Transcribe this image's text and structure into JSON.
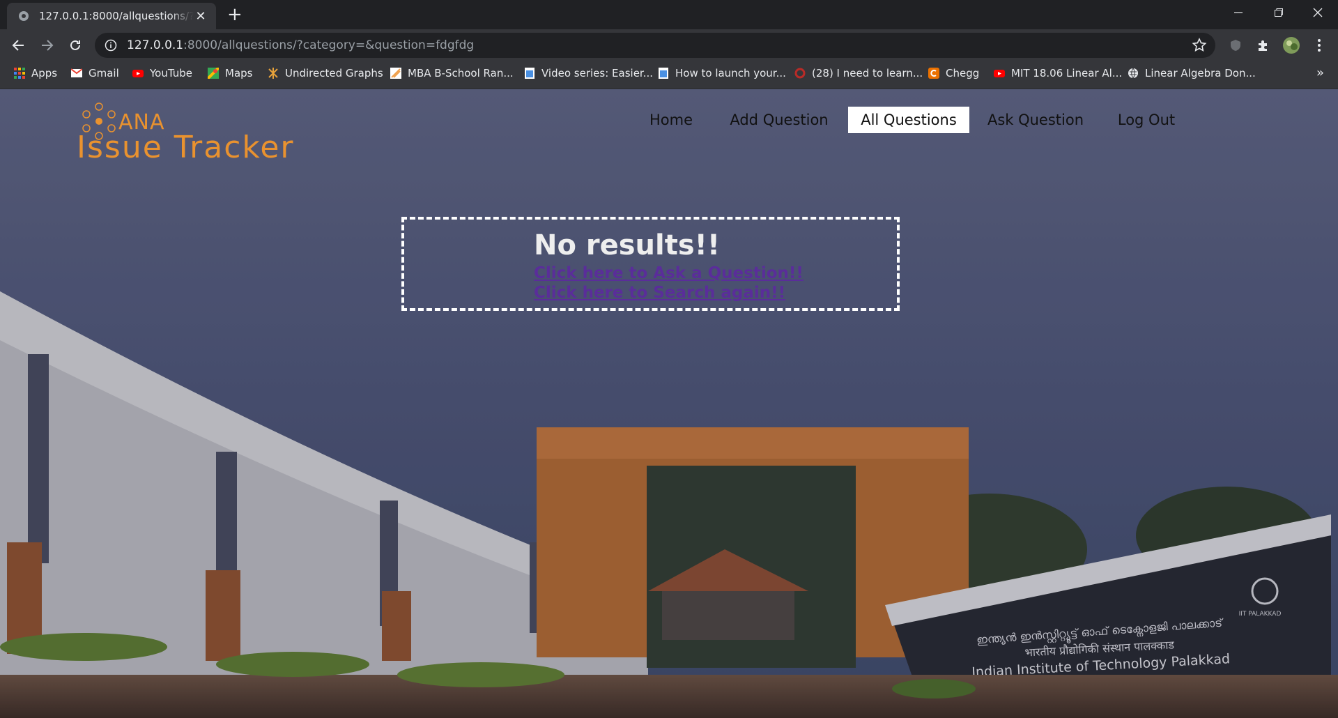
{
  "browser": {
    "tab_title": "127.0.0.1:8000/allquestions/?category=&question=fdgfdg",
    "url_host": "127.0.0.1",
    "url_rest": ":8000/allquestions/?category=&question=fdgfdg",
    "bookmarks": [
      {
        "label": "Apps",
        "icon": "apps-grid-icon",
        "color": "#4285f4"
      },
      {
        "label": "Gmail",
        "icon": "gmail-icon",
        "color": "#ea4335"
      },
      {
        "label": "YouTube",
        "icon": "youtube-icon",
        "color": "#ff0000"
      },
      {
        "label": "Maps",
        "icon": "maps-icon",
        "color": "#34a853"
      },
      {
        "label": "Undirected Graphs",
        "icon": "graph-icon",
        "color": "#e8a33a"
      },
      {
        "label": "MBA B-School Ran...",
        "icon": "ranking-icon",
        "color": "#f0a04b"
      },
      {
        "label": "Video series: Easier...",
        "icon": "docs-icon",
        "color": "#4a90e2"
      },
      {
        "label": "How to launch your...",
        "icon": "docs-icon",
        "color": "#4a90e2"
      },
      {
        "label": "(28) I need to learn...",
        "icon": "quora-icon",
        "color": "#b92b27"
      },
      {
        "label": "Chegg",
        "icon": "chegg-icon",
        "color": "#eb7100"
      },
      {
        "label": "MIT 18.06 Linear Al...",
        "icon": "youtube-icon",
        "color": "#ff0000"
      },
      {
        "label": "Linear Algebra Don...",
        "icon": "globe-icon",
        "color": "#e8eaed"
      }
    ],
    "more": "»"
  },
  "site": {
    "logo_top": "ANA",
    "logo_bottom": "Issue Tracker",
    "accent": "#e9922f",
    "nav": [
      {
        "label": "Home",
        "active": false
      },
      {
        "label": "Add Question",
        "active": false
      },
      {
        "label": "All Questions",
        "active": true
      },
      {
        "label": "Ask Question",
        "active": false
      },
      {
        "label": "Log Out",
        "active": false
      }
    ]
  },
  "result": {
    "heading": "No results!!",
    "ask_link": "Click here to Ask a Question!!",
    "search_link": "Click here to Search again!!",
    "link_color": "#5a2d9a"
  },
  "background": {
    "sign_line1": "ഇന്ത്യൻ ഇൻസ്റ്റിറ്റ്യൂട്ട് ഓഫ് ടെക്നോളജി പാലക്കാട്",
    "sign_line2": "भारतीय प्रौद्योगिकी संस्थान पालक्काड",
    "sign_line3": "Indian Institute of Technology Palakkad",
    "sign_badge": "IIT PALAKKAD"
  }
}
